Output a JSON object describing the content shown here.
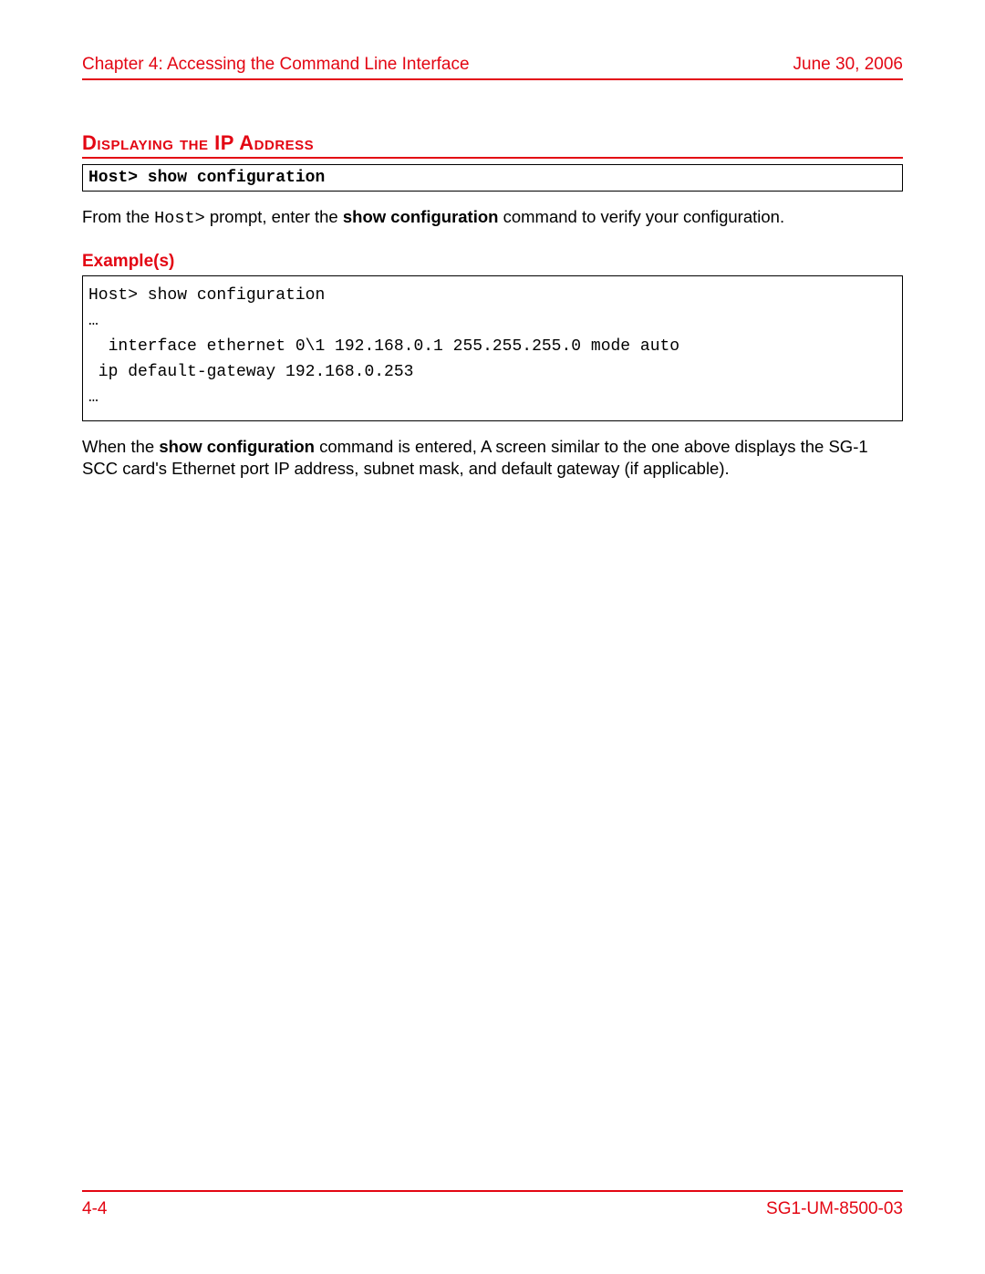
{
  "header": {
    "left": "Chapter 4: Accessing the Command Line Interface",
    "right": "June 30, 2006"
  },
  "section_title": "Displaying the IP Address",
  "command_box": "Host> show configuration",
  "intro": {
    "pre": "From the ",
    "mono": "Host>",
    "mid": " prompt, enter the ",
    "bold": "show configuration",
    "post": " command to verify your configuration."
  },
  "examples_label": "Example(s)",
  "example_output": "Host> show configuration\n…\n  interface ethernet 0\\1 192.168.0.1 255.255.255.0 mode auto\n ip default-gateway 192.168.0.253\n…",
  "outro": {
    "pre": "When the ",
    "bold": "show configuration",
    "post": " command is entered, A screen similar to the one above displays the SG-1 SCC card's Ethernet port IP address, subnet mask, and default gateway (if applicable)."
  },
  "footer": {
    "left": "4-4",
    "right": "SG1-UM-8500-03"
  }
}
